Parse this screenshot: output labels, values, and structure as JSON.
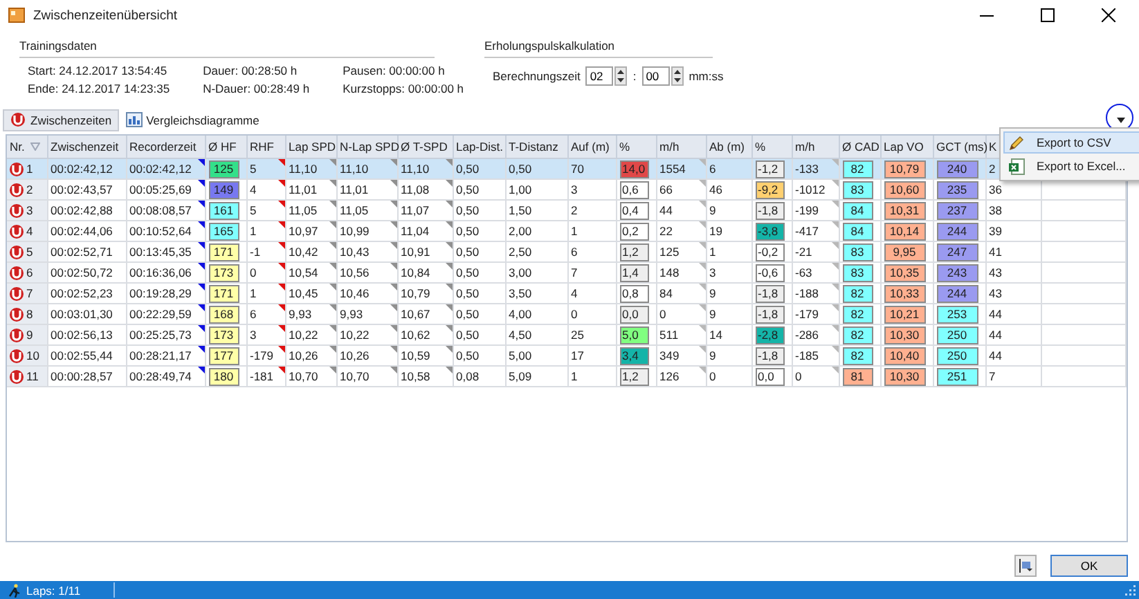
{
  "window": {
    "title": "Zwischenzeitenübersicht"
  },
  "training": {
    "title": "Trainingsdaten",
    "fields": [
      [
        "Start: 24.12.2017 13:54:45",
        "Ende: 24.12.2017 14:23:35"
      ],
      [
        "Dauer: 00:28:50 h",
        "N-Dauer: 00:28:49 h"
      ],
      [
        "Pausen: 00:00:00 h",
        "Kurzstopps: 00:00:00 h"
      ]
    ]
  },
  "recovery": {
    "title": "Erholungspulskalkulation",
    "label": "Berechnungszeit",
    "minutes": "02",
    "separator": ":",
    "seconds": "00",
    "unit": "mm:ss"
  },
  "tabs": [
    {
      "label": "Zwischenzeiten",
      "selected": true,
      "kind": "laps"
    },
    {
      "label": "Vergleichsdiagramme",
      "selected": false,
      "kind": "chart"
    }
  ],
  "menu": {
    "items": [
      {
        "label": "Export to CSV",
        "selected": true,
        "kind": "csv"
      },
      {
        "label": "Export to Excel...",
        "selected": false,
        "kind": "excel"
      }
    ]
  },
  "table": {
    "columns": [
      {
        "label": "Nr.",
        "kind": "lap"
      },
      {
        "label": "Zwischenzeit",
        "kind": "text"
      },
      {
        "label": "Recorderzeit",
        "kind": "text",
        "color": "#1010e0"
      },
      {
        "label": "Ø HF",
        "kind": "box"
      },
      {
        "label": "RHF",
        "kind": "text",
        "color": "#e01010"
      },
      {
        "label": "Lap SPD",
        "kind": "text",
        "color": "#909090"
      },
      {
        "label": "N-Lap SPD",
        "kind": "text",
        "color": "#909090"
      },
      {
        "label": "Ø T-SPD",
        "kind": "text",
        "color": "#909090"
      },
      {
        "label": "Lap-Dist.",
        "kind": "text"
      },
      {
        "label": "T-Distanz",
        "kind": "text"
      },
      {
        "label": "Auf (m)",
        "kind": "text"
      },
      {
        "label": "%",
        "kind": "box-left"
      },
      {
        "label": "m/h",
        "kind": "text",
        "color": "#b8b8b8"
      },
      {
        "label": "Ab (m)",
        "kind": "text"
      },
      {
        "label": "%",
        "kind": "box-left"
      },
      {
        "label": "m/h",
        "kind": "text",
        "color": "#b8b8b8"
      },
      {
        "label": "Ø CAD",
        "kind": "box"
      },
      {
        "label": "Lap VO",
        "kind": "box"
      },
      {
        "label": "GCT (ms)",
        "kind": "box"
      },
      {
        "label": "K",
        "kind": "text"
      }
    ],
    "rows": [
      {
        "selected": true,
        "cells": [
          {
            "text": "1"
          },
          {
            "text": "00:02:42,12"
          },
          {
            "text": "00:02:42,12"
          },
          {
            "text": "125",
            "color": "#33e08a"
          },
          {
            "text": "5"
          },
          {
            "text": "11,10"
          },
          {
            "text": "11,10"
          },
          {
            "text": "11,10"
          },
          {
            "text": "0,50"
          },
          {
            "text": "0,50"
          },
          {
            "text": "70"
          },
          {
            "text": "14,0",
            "color": "#e04848"
          },
          {
            "text": "1554"
          },
          {
            "text": "6"
          },
          {
            "text": "-1,2",
            "color": "#eeeeee"
          },
          {
            "text": "-133"
          },
          {
            "text": "82",
            "color": "#80ffff"
          },
          {
            "text": "10,79",
            "color": "#ffb090"
          },
          {
            "text": "240",
            "color": "#9a9af0"
          },
          {
            "text": "2"
          }
        ]
      },
      {
        "selected": false,
        "cells": [
          {
            "text": "2"
          },
          {
            "text": "00:02:43,57"
          },
          {
            "text": "00:05:25,69"
          },
          {
            "text": "149",
            "color": "#7878f0"
          },
          {
            "text": "4"
          },
          {
            "text": "11,01"
          },
          {
            "text": "11,01"
          },
          {
            "text": "11,08"
          },
          {
            "text": "0,50"
          },
          {
            "text": "1,00"
          },
          {
            "text": "3"
          },
          {
            "text": "0,6",
            "color": "#ffffff"
          },
          {
            "text": "66"
          },
          {
            "text": "46"
          },
          {
            "text": "-9,2",
            "color": "#ffd070"
          },
          {
            "text": "-1012"
          },
          {
            "text": "83",
            "color": "#80ffff"
          },
          {
            "text": "10,60",
            "color": "#ffb090"
          },
          {
            "text": "235",
            "color": "#9a9af0"
          },
          {
            "text": "36"
          }
        ]
      },
      {
        "selected": false,
        "cells": [
          {
            "text": "3"
          },
          {
            "text": "00:02:42,88"
          },
          {
            "text": "00:08:08,57"
          },
          {
            "text": "161",
            "color": "#80ffff"
          },
          {
            "text": "5"
          },
          {
            "text": "11,05"
          },
          {
            "text": "11,05"
          },
          {
            "text": "11,07"
          },
          {
            "text": "0,50"
          },
          {
            "text": "1,50"
          },
          {
            "text": "2"
          },
          {
            "text": "0,4",
            "color": "#ffffff"
          },
          {
            "text": "44"
          },
          {
            "text": "9"
          },
          {
            "text": "-1,8",
            "color": "#eeeeee"
          },
          {
            "text": "-199"
          },
          {
            "text": "84",
            "color": "#80ffff"
          },
          {
            "text": "10,31",
            "color": "#ffb090"
          },
          {
            "text": "237",
            "color": "#9a9af0"
          },
          {
            "text": "38"
          }
        ]
      },
      {
        "selected": false,
        "cells": [
          {
            "text": "4"
          },
          {
            "text": "00:02:44,06"
          },
          {
            "text": "00:10:52,64"
          },
          {
            "text": "165",
            "color": "#80ffff"
          },
          {
            "text": "1"
          },
          {
            "text": "10,97"
          },
          {
            "text": "10,99"
          },
          {
            "text": "11,04"
          },
          {
            "text": "0,50"
          },
          {
            "text": "2,00"
          },
          {
            "text": "1"
          },
          {
            "text": "0,2",
            "color": "#ffffff"
          },
          {
            "text": "22"
          },
          {
            "text": "19"
          },
          {
            "text": "-3,8",
            "color": "#14b4a8"
          },
          {
            "text": "-417"
          },
          {
            "text": "84",
            "color": "#80ffff"
          },
          {
            "text": "10,14",
            "color": "#ffb090"
          },
          {
            "text": "244",
            "color": "#9a9af0"
          },
          {
            "text": "39"
          }
        ]
      },
      {
        "selected": false,
        "cells": [
          {
            "text": "5"
          },
          {
            "text": "00:02:52,71"
          },
          {
            "text": "00:13:45,35"
          },
          {
            "text": "171",
            "color": "#ffffa8"
          },
          {
            "text": "-1"
          },
          {
            "text": "10,42"
          },
          {
            "text": "10,43"
          },
          {
            "text": "10,91"
          },
          {
            "text": "0,50"
          },
          {
            "text": "2,50"
          },
          {
            "text": "6"
          },
          {
            "text": "1,2",
            "color": "#eeeeee"
          },
          {
            "text": "125"
          },
          {
            "text": "1"
          },
          {
            "text": "-0,2",
            "color": "#ffffff"
          },
          {
            "text": "-21"
          },
          {
            "text": "83",
            "color": "#80ffff"
          },
          {
            "text": "9,95",
            "color": "#ffb090"
          },
          {
            "text": "247",
            "color": "#9a9af0"
          },
          {
            "text": "41"
          }
        ]
      },
      {
        "selected": false,
        "cells": [
          {
            "text": "6"
          },
          {
            "text": "00:02:50,72"
          },
          {
            "text": "00:16:36,06"
          },
          {
            "text": "173",
            "color": "#ffffa8"
          },
          {
            "text": "0"
          },
          {
            "text": "10,54"
          },
          {
            "text": "10,56"
          },
          {
            "text": "10,84"
          },
          {
            "text": "0,50"
          },
          {
            "text": "3,00"
          },
          {
            "text": "7"
          },
          {
            "text": "1,4",
            "color": "#eeeeee"
          },
          {
            "text": "148"
          },
          {
            "text": "3"
          },
          {
            "text": "-0,6",
            "color": "#ffffff"
          },
          {
            "text": "-63"
          },
          {
            "text": "83",
            "color": "#80ffff"
          },
          {
            "text": "10,35",
            "color": "#ffb090"
          },
          {
            "text": "243",
            "color": "#9a9af0"
          },
          {
            "text": "43"
          }
        ]
      },
      {
        "selected": false,
        "cells": [
          {
            "text": "7"
          },
          {
            "text": "00:02:52,23"
          },
          {
            "text": "00:19:28,29"
          },
          {
            "text": "171",
            "color": "#ffffa8"
          },
          {
            "text": "1"
          },
          {
            "text": "10,45"
          },
          {
            "text": "10,46"
          },
          {
            "text": "10,79"
          },
          {
            "text": "0,50"
          },
          {
            "text": "3,50"
          },
          {
            "text": "4"
          },
          {
            "text": "0,8",
            "color": "#ffffff"
          },
          {
            "text": "84"
          },
          {
            "text": "9"
          },
          {
            "text": "-1,8",
            "color": "#eeeeee"
          },
          {
            "text": "-188"
          },
          {
            "text": "82",
            "color": "#80ffff"
          },
          {
            "text": "10,33",
            "color": "#ffb090"
          },
          {
            "text": "244",
            "color": "#9a9af0"
          },
          {
            "text": "43"
          }
        ]
      },
      {
        "selected": false,
        "cells": [
          {
            "text": "8"
          },
          {
            "text": "00:03:01,30"
          },
          {
            "text": "00:22:29,59"
          },
          {
            "text": "168",
            "color": "#ffffa8"
          },
          {
            "text": "6"
          },
          {
            "text": "9,93"
          },
          {
            "text": "9,93"
          },
          {
            "text": "10,67"
          },
          {
            "text": "0,50"
          },
          {
            "text": "4,00"
          },
          {
            "text": "0"
          },
          {
            "text": "0,0",
            "color": "#eeeeee"
          },
          {
            "text": "0"
          },
          {
            "text": "9"
          },
          {
            "text": "-1,8",
            "color": "#eeeeee"
          },
          {
            "text": "-179"
          },
          {
            "text": "82",
            "color": "#80ffff"
          },
          {
            "text": "10,21",
            "color": "#ffb090"
          },
          {
            "text": "253",
            "color": "#80ffff"
          },
          {
            "text": "44"
          }
        ]
      },
      {
        "selected": false,
        "cells": [
          {
            "text": "9"
          },
          {
            "text": "00:02:56,13"
          },
          {
            "text": "00:25:25,73"
          },
          {
            "text": "173",
            "color": "#ffffa8"
          },
          {
            "text": "3"
          },
          {
            "text": "10,22"
          },
          {
            "text": "10,22"
          },
          {
            "text": "10,62"
          },
          {
            "text": "0,50"
          },
          {
            "text": "4,50"
          },
          {
            "text": "25"
          },
          {
            "text": "5,0",
            "color": "#80ff80"
          },
          {
            "text": "511"
          },
          {
            "text": "14"
          },
          {
            "text": "-2,8",
            "color": "#14b4a8"
          },
          {
            "text": "-286"
          },
          {
            "text": "82",
            "color": "#80ffff"
          },
          {
            "text": "10,30",
            "color": "#ffb090"
          },
          {
            "text": "250",
            "color": "#80ffff"
          },
          {
            "text": "44"
          }
        ]
      },
      {
        "selected": false,
        "cells": [
          {
            "text": "10"
          },
          {
            "text": "00:02:55,44"
          },
          {
            "text": "00:28:21,17"
          },
          {
            "text": "177",
            "color": "#ffffa8"
          },
          {
            "text": "-179"
          },
          {
            "text": "10,26"
          },
          {
            "text": "10,26"
          },
          {
            "text": "10,59"
          },
          {
            "text": "0,50"
          },
          {
            "text": "5,00"
          },
          {
            "text": "17"
          },
          {
            "text": "3,4",
            "color": "#14b4a8"
          },
          {
            "text": "349"
          },
          {
            "text": "9"
          },
          {
            "text": "-1,8",
            "color": "#eeeeee"
          },
          {
            "text": "-185"
          },
          {
            "text": "82",
            "color": "#80ffff"
          },
          {
            "text": "10,40",
            "color": "#ffb090"
          },
          {
            "text": "250",
            "color": "#80ffff"
          },
          {
            "text": "44"
          }
        ]
      },
      {
        "selected": false,
        "cells": [
          {
            "text": "11"
          },
          {
            "text": "00:00:28,57"
          },
          {
            "text": "00:28:49,74"
          },
          {
            "text": "180",
            "color": "#ffffa8"
          },
          {
            "text": "-181"
          },
          {
            "text": "10,70"
          },
          {
            "text": "10,70"
          },
          {
            "text": "10,58"
          },
          {
            "text": "0,08"
          },
          {
            "text": "5,09"
          },
          {
            "text": "1"
          },
          {
            "text": "1,2",
            "color": "#eeeeee"
          },
          {
            "text": "126"
          },
          {
            "text": "0"
          },
          {
            "text": "0,0",
            "color": "#ffffff"
          },
          {
            "text": "0"
          },
          {
            "text": "81",
            "color": "#ffb090"
          },
          {
            "text": "10,30",
            "color": "#ffb090"
          },
          {
            "text": "251",
            "color": "#80ffff"
          },
          {
            "text": "7"
          }
        ]
      }
    ]
  },
  "buttons": [
    {
      "label": "OK"
    }
  ],
  "status_bar": {
    "text": "Laps: 1/11"
  }
}
